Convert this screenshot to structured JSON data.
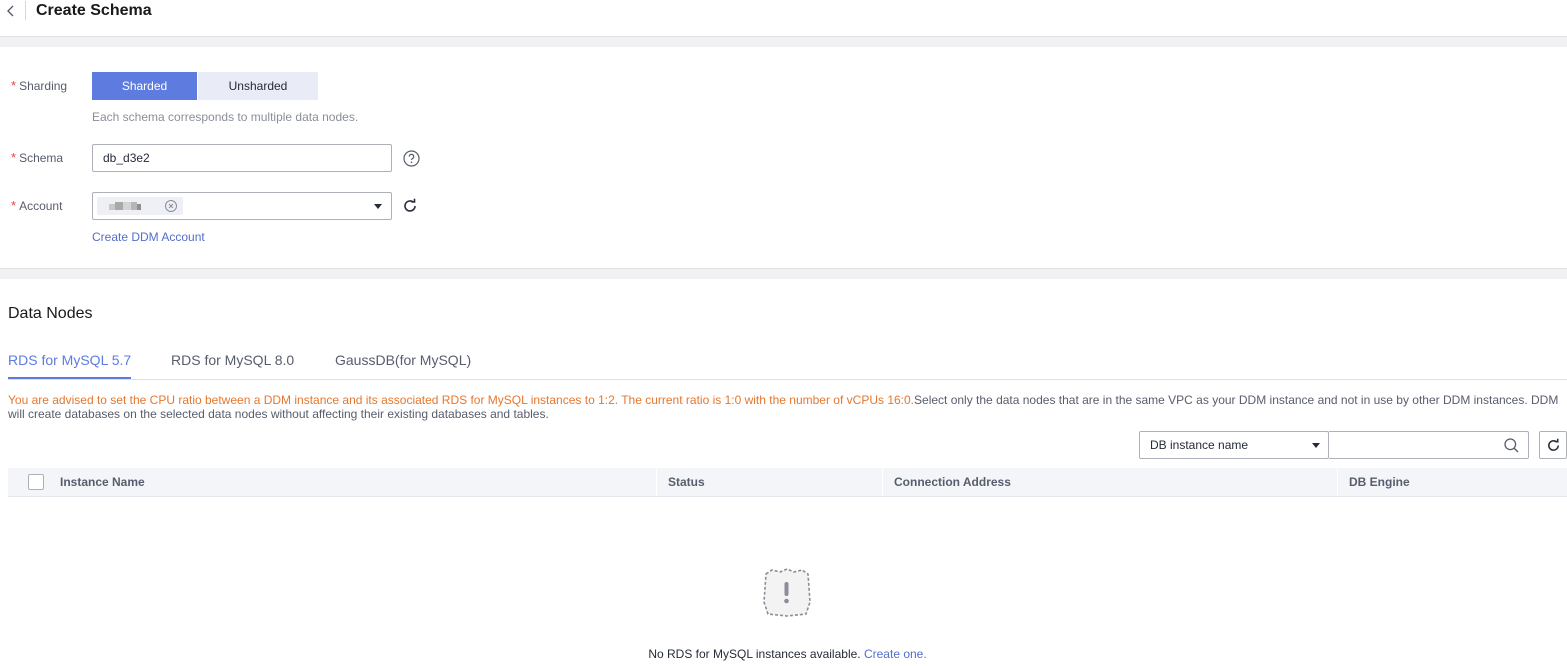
{
  "header": {
    "title": "Create Schema"
  },
  "form": {
    "sharding": {
      "label": "Sharding",
      "options": [
        "Sharded",
        "Unsharded"
      ],
      "selected": "Sharded",
      "hint": "Each schema corresponds to multiple data nodes."
    },
    "schema": {
      "label": "Schema",
      "value": "db_d3e2"
    },
    "account": {
      "label": "Account",
      "selected_tag": "",
      "create_link": "Create DDM Account"
    },
    "required_mark": "*"
  },
  "data_nodes": {
    "title": "Data Nodes",
    "tabs": [
      "RDS for MySQL 5.7",
      "RDS for MySQL 8.0",
      "GaussDB(for MySQL)"
    ],
    "active_tab": "RDS for MySQL 5.7",
    "warning_highlight": "You are advised to set the CPU ratio between a DDM instance and its associated RDS for MySQL instances to 1:2. The current ratio is 1:0 with the number of vCPUs 16:0.",
    "warning_rest": "Select only the data nodes that are in the same VPC as your DDM instance and not in use by other DDM instances. DDM will create databases on the selected data nodes without affecting their existing databases and tables.",
    "filter": {
      "field": "DB instance name",
      "search_value": ""
    },
    "columns": [
      "Instance Name",
      "Status",
      "Connection Address",
      "DB Engine"
    ],
    "empty_text": "No RDS for MySQL instances available.",
    "empty_link": "Create one."
  },
  "colors": {
    "primary": "#5e7ce0",
    "warning": "#e6772c",
    "required": "#e54545",
    "link": "#526ecc"
  }
}
